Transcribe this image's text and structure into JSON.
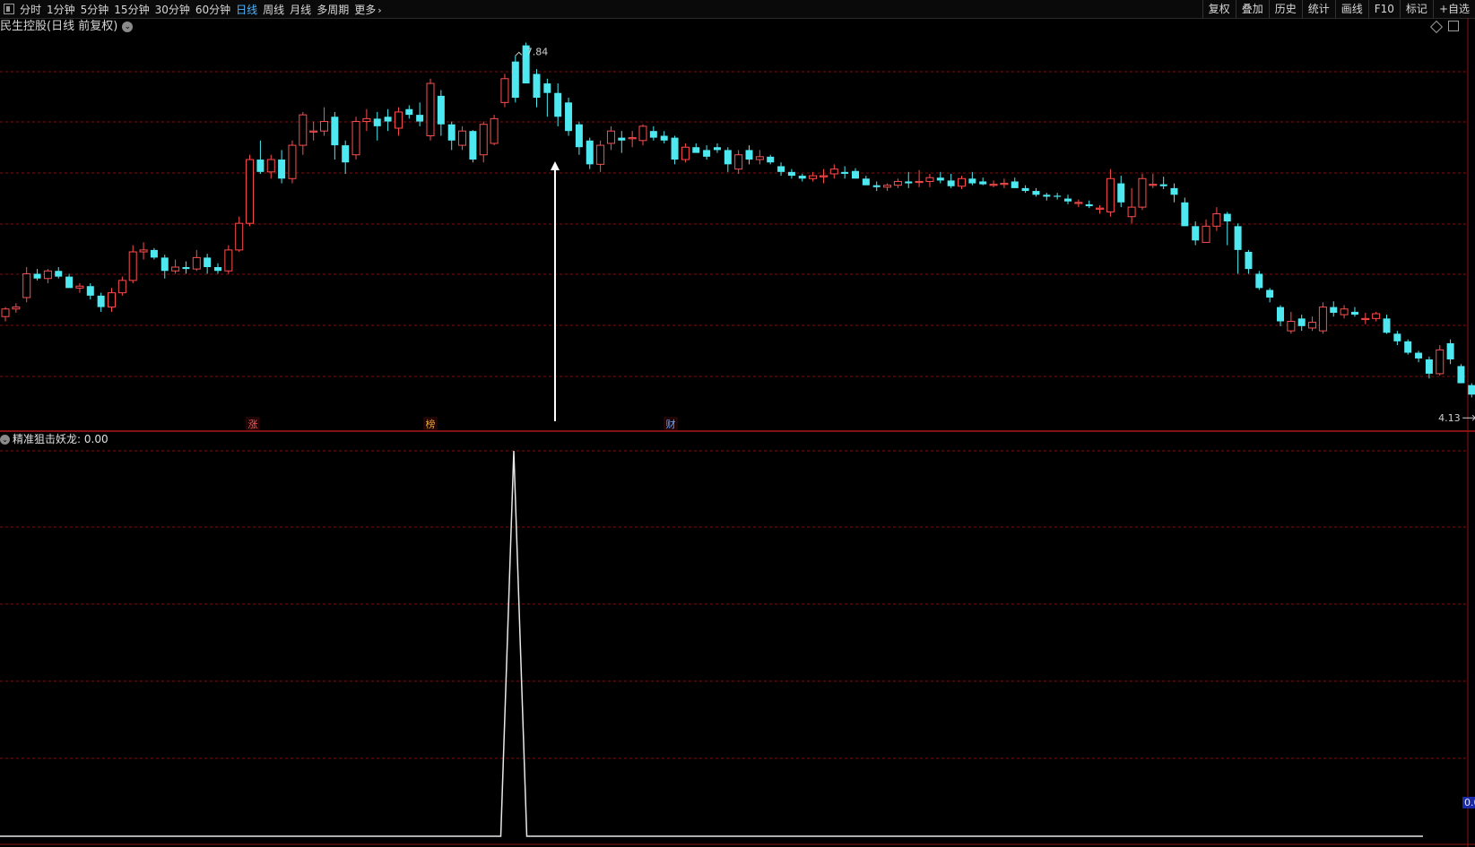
{
  "toolbar": {
    "periods": [
      {
        "label": "分时",
        "active": false
      },
      {
        "label": "1分钟",
        "active": false
      },
      {
        "label": "5分钟",
        "active": false
      },
      {
        "label": "15分钟",
        "active": false
      },
      {
        "label": "30分钟",
        "active": false
      },
      {
        "label": "60分钟",
        "active": false
      },
      {
        "label": "日线",
        "active": true
      },
      {
        "label": "周线",
        "active": false
      },
      {
        "label": "月线",
        "active": false
      },
      {
        "label": "多周期",
        "active": false
      }
    ],
    "more_label": "更多",
    "tools": [
      "复权",
      "叠加",
      "历史",
      "统计",
      "画线",
      "F10",
      "标记",
      "+自选"
    ]
  },
  "main": {
    "title": "民生控股(日线 前复权)",
    "high_label": "7.84",
    "low_label": "4.13",
    "markers": [
      {
        "text": "涨",
        "color": "#ff5a5a",
        "index": 27
      },
      {
        "text": "榜",
        "color": "#e8a33a",
        "index": 46
      },
      {
        "text": "财",
        "color": "#6aa8ff",
        "index": 74
      }
    ]
  },
  "indicator": {
    "title": "精准狙击妖龙",
    "value": ": 0.00",
    "axis_value": "0.0"
  },
  "colors": {
    "up": "#ff4d4d",
    "down": "#4ee8f0",
    "grid": "#7a1010",
    "signal": "#ffffff",
    "active_period": "#4fb4ff"
  },
  "chart_data": [
    {
      "type": "candlestick",
      "title": "民生控股(日线 前复权)",
      "candles": [
        [
          5.1,
          5.2,
          5.05,
          5.18
        ],
        [
          5.18,
          5.24,
          5.14,
          5.2
        ],
        [
          5.3,
          5.62,
          5.25,
          5.55
        ],
        [
          5.55,
          5.6,
          5.48,
          5.5
        ],
        [
          5.5,
          5.6,
          5.45,
          5.58
        ],
        [
          5.58,
          5.62,
          5.5,
          5.52
        ],
        [
          5.52,
          5.55,
          5.42,
          5.4
        ],
        [
          5.4,
          5.45,
          5.35,
          5.42
        ],
        [
          5.42,
          5.45,
          5.28,
          5.32
        ],
        [
          5.32,
          5.35,
          5.15,
          5.2
        ],
        [
          5.2,
          5.4,
          5.15,
          5.35
        ],
        [
          5.35,
          5.52,
          5.32,
          5.48
        ],
        [
          5.48,
          5.85,
          5.45,
          5.78
        ],
        [
          5.78,
          5.88,
          5.7,
          5.8
        ],
        [
          5.8,
          5.82,
          5.7,
          5.72
        ],
        [
          5.72,
          5.75,
          5.5,
          5.58
        ],
        [
          5.58,
          5.7,
          5.55,
          5.62
        ],
        [
          5.62,
          5.68,
          5.55,
          5.6
        ],
        [
          5.6,
          5.8,
          5.58,
          5.72
        ],
        [
          5.72,
          5.76,
          5.55,
          5.62
        ],
        [
          5.62,
          5.66,
          5.55,
          5.58
        ],
        [
          5.58,
          5.85,
          5.55,
          5.8
        ],
        [
          5.8,
          6.15,
          5.78,
          6.08
        ],
        [
          6.08,
          6.8,
          6.05,
          6.75
        ],
        [
          6.75,
          6.95,
          6.6,
          6.62
        ],
        [
          6.62,
          6.8,
          6.55,
          6.75
        ],
        [
          6.75,
          6.85,
          6.5,
          6.55
        ],
        [
          6.55,
          6.95,
          6.5,
          6.9
        ],
        [
          6.9,
          7.25,
          6.8,
          7.22
        ],
        [
          7.05,
          7.15,
          6.95,
          7.05
        ],
        [
          7.05,
          7.3,
          7.0,
          7.15
        ],
        [
          7.2,
          7.25,
          6.75,
          6.9
        ],
        [
          6.9,
          6.95,
          6.6,
          6.72
        ],
        [
          6.8,
          7.2,
          6.75,
          7.15
        ],
        [
          7.15,
          7.28,
          7.05,
          7.18
        ],
        [
          7.18,
          7.25,
          6.95,
          7.1
        ],
        [
          7.2,
          7.28,
          7.05,
          7.15
        ],
        [
          7.08,
          7.3,
          7.0,
          7.25
        ],
        [
          7.28,
          7.32,
          7.18,
          7.22
        ],
        [
          7.22,
          7.35,
          7.1,
          7.15
        ],
        [
          7.0,
          7.6,
          6.95,
          7.55
        ],
        [
          7.42,
          7.48,
          7.0,
          7.12
        ],
        [
          7.12,
          7.15,
          6.85,
          6.95
        ],
        [
          6.9,
          7.1,
          6.85,
          7.05
        ],
        [
          7.05,
          7.06,
          6.72,
          6.75
        ],
        [
          6.8,
          7.15,
          6.72,
          7.12
        ],
        [
          6.92,
          7.22,
          6.9,
          7.18
        ],
        [
          7.35,
          7.65,
          7.3,
          7.6
        ],
        [
          7.78,
          7.84,
          7.35,
          7.4
        ],
        [
          7.95,
          7.98,
          7.56,
          7.55
        ],
        [
          7.65,
          7.7,
          7.3,
          7.4
        ],
        [
          7.55,
          7.6,
          7.2,
          7.45
        ],
        [
          7.45,
          7.55,
          7.1,
          7.2
        ],
        [
          7.35,
          7.4,
          7.0,
          7.05
        ],
        [
          7.12,
          7.15,
          6.8,
          6.88
        ],
        [
          6.95,
          6.98,
          6.65,
          6.7
        ],
        [
          6.7,
          6.95,
          6.62,
          6.9
        ],
        [
          6.92,
          7.1,
          6.85,
          7.05
        ],
        [
          6.98,
          7.05,
          6.82,
          6.95
        ],
        [
          6.98,
          7.05,
          6.88,
          6.98
        ],
        [
          6.95,
          7.12,
          6.9,
          7.1
        ],
        [
          7.05,
          7.1,
          6.95,
          6.98
        ],
        [
          7.0,
          7.05,
          6.92,
          6.95
        ],
        [
          6.98,
          7.0,
          6.7,
          6.75
        ],
        [
          6.75,
          6.92,
          6.72,
          6.88
        ],
        [
          6.88,
          6.92,
          6.82,
          6.82
        ],
        [
          6.85,
          6.9,
          6.75,
          6.78
        ],
        [
          6.88,
          6.92,
          6.82,
          6.85
        ],
        [
          6.85,
          6.88,
          6.62,
          6.7
        ],
        [
          6.65,
          6.85,
          6.6,
          6.8
        ],
        [
          6.85,
          6.9,
          6.7,
          6.75
        ],
        [
          6.75,
          6.85,
          6.7,
          6.78
        ],
        [
          6.78,
          6.8,
          6.7,
          6.72
        ],
        [
          6.68,
          6.72,
          6.58,
          6.62
        ],
        [
          6.62,
          6.65,
          6.55,
          6.58
        ],
        [
          6.58,
          6.6,
          6.52,
          6.55
        ],
        [
          6.55,
          6.62,
          6.52,
          6.58
        ],
        [
          6.58,
          6.65,
          6.5,
          6.58
        ],
        [
          6.6,
          6.7,
          6.55,
          6.65
        ],
        [
          6.62,
          6.68,
          6.55,
          6.6
        ],
        [
          6.63,
          6.66,
          6.55,
          6.55
        ],
        [
          6.55,
          6.58,
          6.48,
          6.48
        ],
        [
          6.48,
          6.52,
          6.42,
          6.46
        ],
        [
          6.46,
          6.5,
          6.42,
          6.48
        ],
        [
          6.48,
          6.55,
          6.45,
          6.52
        ],
        [
          6.52,
          6.62,
          6.45,
          6.5
        ],
        [
          6.52,
          6.64,
          6.46,
          6.52
        ],
        [
          6.52,
          6.6,
          6.46,
          6.56
        ],
        [
          6.56,
          6.62,
          6.5,
          6.53
        ],
        [
          6.53,
          6.6,
          6.45,
          6.47
        ],
        [
          6.47,
          6.58,
          6.44,
          6.55
        ],
        [
          6.55,
          6.62,
          6.48,
          6.5
        ],
        [
          6.52,
          6.56,
          6.48,
          6.49
        ],
        [
          6.49,
          6.53,
          6.46,
          6.49
        ],
        [
          6.49,
          6.55,
          6.45,
          6.5
        ],
        [
          6.52,
          6.56,
          6.45,
          6.45
        ],
        [
          6.45,
          6.48,
          6.4,
          6.42
        ],
        [
          6.42,
          6.45,
          6.36,
          6.38
        ],
        [
          6.38,
          6.4,
          6.32,
          6.36
        ],
        [
          6.37,
          6.4,
          6.33,
          6.36
        ],
        [
          6.34,
          6.38,
          6.28,
          6.31
        ],
        [
          6.3,
          6.33,
          6.25,
          6.3
        ],
        [
          6.28,
          6.32,
          6.24,
          6.26
        ],
        [
          6.24,
          6.27,
          6.18,
          6.24
        ],
        [
          6.2,
          6.65,
          6.15,
          6.55
        ],
        [
          6.5,
          6.58,
          6.25,
          6.3
        ],
        [
          6.15,
          6.45,
          6.08,
          6.25
        ],
        [
          6.25,
          6.6,
          6.22,
          6.55
        ],
        [
          6.48,
          6.6,
          6.45,
          6.49
        ],
        [
          6.49,
          6.57,
          6.44,
          6.47
        ],
        [
          6.45,
          6.5,
          6.3,
          6.38
        ],
        [
          6.3,
          6.35,
          6.05,
          6.05
        ],
        [
          6.05,
          6.1,
          5.85,
          5.9
        ],
        [
          5.88,
          6.12,
          5.88,
          6.05
        ],
        [
          6.05,
          6.25,
          6.0,
          6.18
        ],
        [
          6.18,
          6.2,
          5.85,
          6.1
        ],
        [
          6.05,
          6.08,
          5.55,
          5.8
        ],
        [
          5.78,
          5.8,
          5.55,
          5.6
        ],
        [
          5.55,
          5.58,
          5.38,
          5.4
        ],
        [
          5.38,
          5.4,
          5.25,
          5.3
        ],
        [
          5.2,
          5.22,
          5.0,
          5.05
        ],
        [
          4.95,
          5.15,
          4.92,
          5.05
        ],
        [
          5.08,
          5.12,
          4.95,
          5.0
        ],
        [
          4.98,
          5.1,
          4.95,
          5.04
        ],
        [
          4.95,
          5.25,
          4.92,
          5.2
        ],
        [
          5.2,
          5.26,
          5.1,
          5.14
        ],
        [
          5.12,
          5.22,
          5.08,
          5.18
        ],
        [
          5.15,
          5.2,
          5.1,
          5.12
        ],
        [
          5.08,
          5.14,
          5.02,
          5.08
        ],
        [
          5.08,
          5.15,
          5.05,
          5.13
        ],
        [
          5.08,
          5.12,
          4.92,
          4.93
        ],
        [
          4.92,
          4.95,
          4.8,
          4.84
        ],
        [
          4.84,
          4.86,
          4.7,
          4.72
        ],
        [
          4.72,
          4.74,
          4.62,
          4.66
        ],
        [
          4.65,
          4.68,
          4.45,
          4.5
        ],
        [
          4.5,
          4.8,
          4.48,
          4.75
        ],
        [
          4.82,
          4.86,
          4.6,
          4.65
        ],
        [
          4.58,
          4.6,
          4.4,
          4.4
        ],
        [
          4.38,
          4.4,
          4.25,
          4.28
        ],
        [
          4.2,
          4.26,
          4.13,
          4.24
        ]
      ],
      "high": 7.84,
      "low": 4.13,
      "y_range": [
        4.0,
        8.05
      ]
    },
    {
      "type": "line",
      "title": "精准狙击妖龙",
      "x": [
        0,
        37,
        40,
        43,
        117
      ],
      "y": [
        0,
        0,
        1,
        0,
        0
      ],
      "signal_index": 40
    }
  ]
}
